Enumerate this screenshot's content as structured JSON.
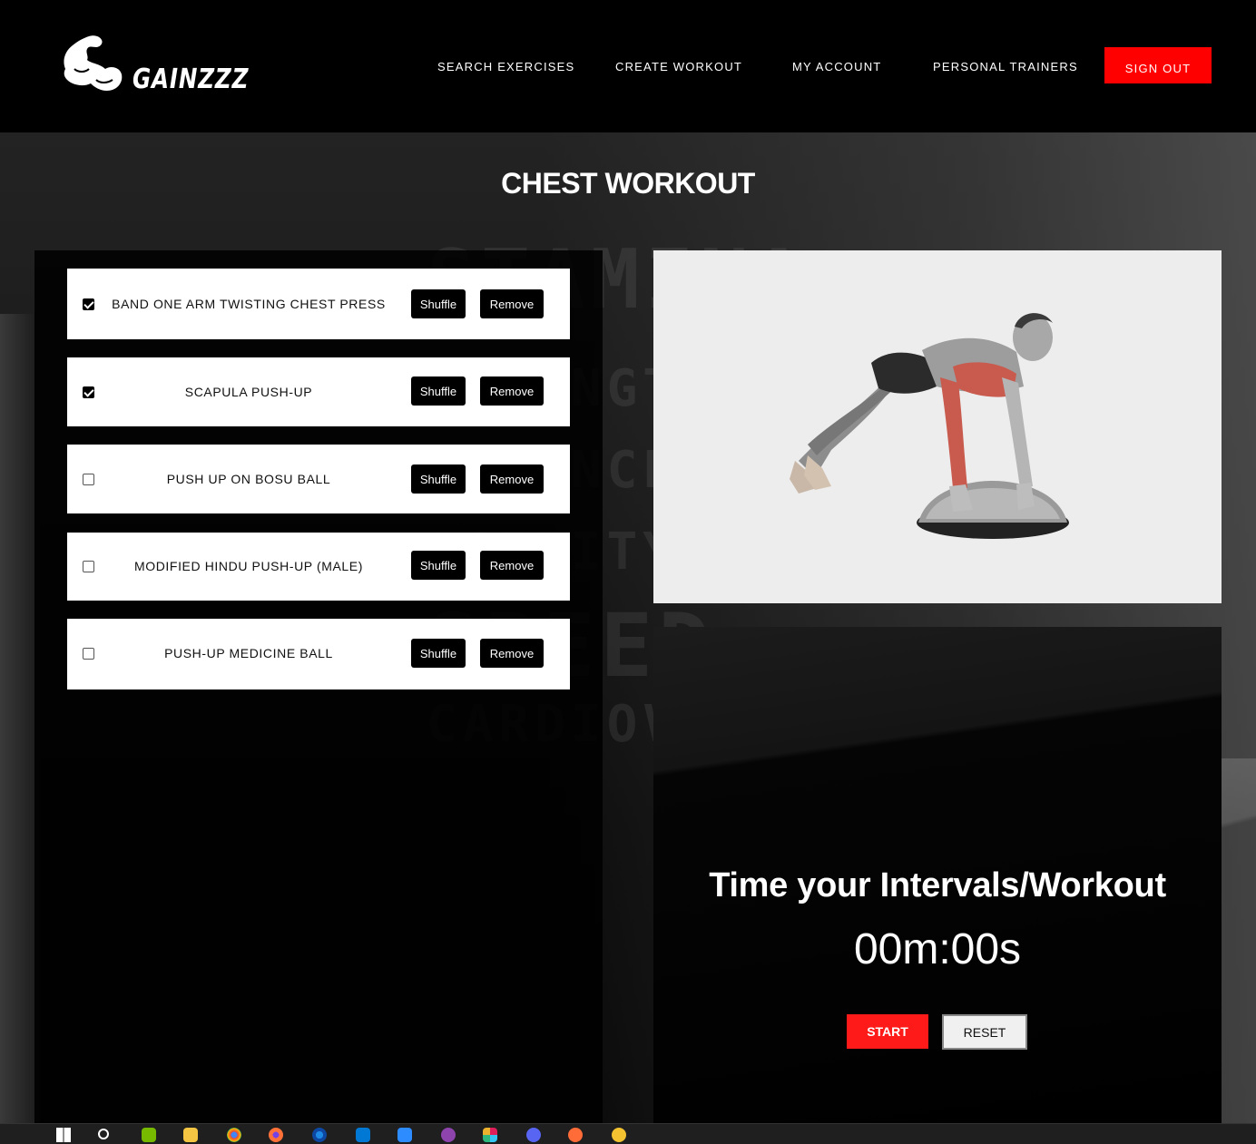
{
  "brand": {
    "name": "GAINZZZ"
  },
  "nav": {
    "items": [
      {
        "label": "SEARCH EXERCISES"
      },
      {
        "label": "CREATE WORKOUT"
      },
      {
        "label": "MY ACCOUNT"
      },
      {
        "label": "PERSONAL TRAINERS"
      }
    ],
    "signout_label": "SIGN OUT"
  },
  "page": {
    "title": "CHEST WORKOUT"
  },
  "exercises": [
    {
      "name": "BAND ONE ARM TWISTING CHEST PRESS",
      "checked": true
    },
    {
      "name": "SCAPULA PUSH-UP",
      "checked": true
    },
    {
      "name": "PUSH UP ON BOSU BALL",
      "checked": false
    },
    {
      "name": "MODIFIED HINDU PUSH-UP (MALE)",
      "checked": false
    },
    {
      "name": "PUSH-UP MEDICINE BALL",
      "checked": false
    }
  ],
  "exercise_buttons": {
    "shuffle": "Shuffle",
    "remove": "Remove"
  },
  "timer": {
    "title": "Time your Intervals/Workout",
    "display": "00m:00s",
    "start_label": "START",
    "reset_label": "RESET"
  },
  "colors": {
    "accent": "#ff0000",
    "card": "#ffffff",
    "panel": "#000000"
  },
  "taskbar": {
    "icons": [
      "windows-icon",
      "search-icon",
      "nvidia-icon",
      "file-explorer-icon",
      "chrome-icon",
      "firefox-icon",
      "firefox-dev-icon",
      "vscode-icon",
      "zoom-icon",
      "github-icon",
      "slack-icon",
      "discord-icon",
      "postman-icon",
      "app-icon"
    ]
  }
}
